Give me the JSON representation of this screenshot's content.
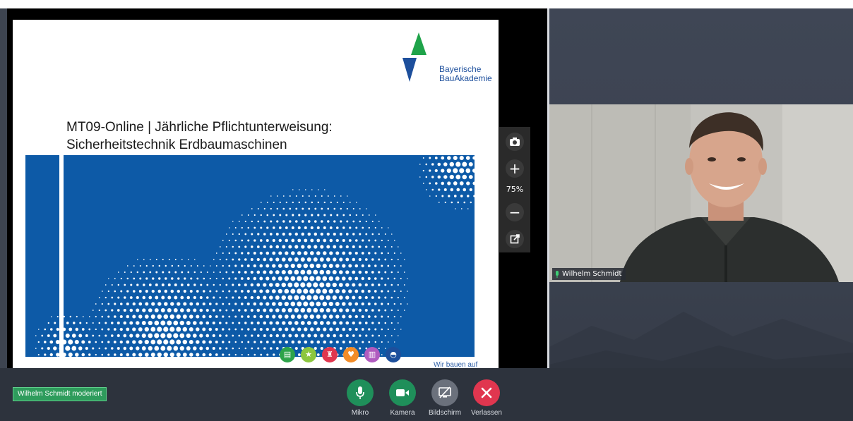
{
  "presentation": {
    "logo": {
      "line1": "Bayerische",
      "line2": "BauAkademie"
    },
    "title_line1": "MT09-Online | Jährliche Pflichtunterweisung:",
    "title_line2": "Sicherheitstechnik Erdbaumaschinen",
    "footer_fragment": "Wir bauen auf"
  },
  "zoom": {
    "level": "75%",
    "icons": [
      "camera-icon",
      "plus-icon",
      "minus-icon",
      "popout-icon"
    ]
  },
  "participant": {
    "name": "Wilhelm Schmidt",
    "mic_status": "active"
  },
  "moderator_badge": "Wilhelm Schmidt moderiert",
  "controls": [
    {
      "label": "Mikro",
      "icon": "microphone-icon",
      "color": "#1f8f5a"
    },
    {
      "label": "Kamera",
      "icon": "camera-video-icon",
      "color": "#1f8f5a"
    },
    {
      "label": "Bildschirm",
      "icon": "screen-share-off-icon",
      "color": "#6b717c"
    },
    {
      "label": "Verlassen",
      "icon": "close-icon",
      "color": "#e0364f"
    }
  ],
  "colors": {
    "slide_blue": "#0d5aa7",
    "logo_green": "#1fa34a",
    "logo_blue": "#1d4f9c",
    "moderator_green": "#2e9c5c"
  }
}
